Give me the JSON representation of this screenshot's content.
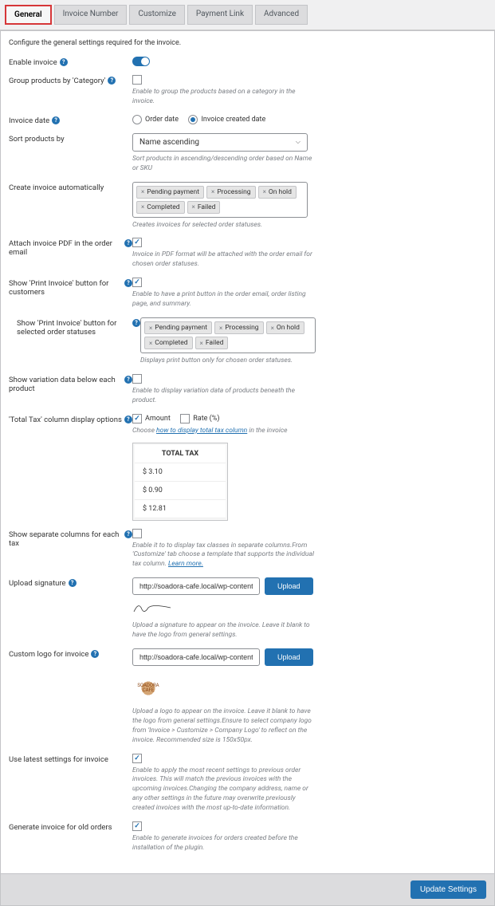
{
  "tabs": [
    "General",
    "Invoice Number",
    "Customize",
    "Payment Link",
    "Advanced"
  ],
  "desc": "Configure the general settings required for the invoice.",
  "statuses": [
    "Pending payment",
    "Processing",
    "On hold",
    "Completed",
    "Failed"
  ],
  "fields": {
    "enable": "Enable invoice",
    "group": "Group products by 'Category'",
    "group_help": "Enable to group the products based on a category in the invoice.",
    "invoice_date": "Invoice date",
    "order_date": "Order date",
    "created_date": "Invoice created date",
    "sort": "Sort products by",
    "sort_val": "Name ascending",
    "sort_help": "Sort products in ascending/descending order based on Name or SKU",
    "auto": "Create invoice automatically",
    "auto_help": "Creates invoices for selected order statuses.",
    "attach": "Attach invoice PDF in the order email",
    "attach_help": "Invoice in PDF format will be attached with the order email for chosen order statuses.",
    "printbtn": "Show 'Print Invoice' button for customers",
    "printbtn_help": "Enable to have a print button in the order email, order listing page, and summary.",
    "printsel": "Show 'Print Invoice' button for selected order statuses",
    "printsel_help": "Displays print button only for chosen order statuses.",
    "variation": "Show variation data below each product",
    "variation_help": "Enable to display variation data of products beneath the product.",
    "totaltax": "'Total Tax' column display options",
    "amount": "Amount",
    "rate": "Rate (%)",
    "totaltax_help1": "Choose ",
    "totaltax_link": "how to display total tax column",
    "totaltax_help2": " in the invoice",
    "tax_header": "TOTAL TAX",
    "tax_vals": [
      "$ 3.10",
      "$ 0.90",
      "$ 12.81"
    ],
    "sepcol": "Show separate columns for each tax",
    "sepcol_help": "Enable it to to display tax classes in separate columns.From 'Customize' tab choose a template that supports the individual tax column. ",
    "sepcol_link": "Learn more.",
    "sig": "Upload signature",
    "sig_val": "http://soadora-cafe.local/wp-content/up",
    "sig_help": "Upload a signature to appear on the invoice. Leave it blank to have the logo from general settings.",
    "logo": "Custom logo for invoice",
    "logo_val": "http://soadora-cafe.local/wp-content/up",
    "logo_help": "Upload a logo to appear on the invoice. Leave it blank to have the logo from general settings.Ensure to select company logo from 'Invoice > Customize > Company Logo' to reflect on the invoice. Recommended size is 150x50px.",
    "latest": "Use latest settings for invoice",
    "latest_help": "Enable to apply the most recent settings to previous order invoices. This will match the previous invoices with the upcoming invoices.Changing the company address, name or any other settings in the future may overwrite previously created invoices with the most up-to-date information.",
    "old": "Generate invoice for old orders",
    "old_help": "Enable to generate invoices for orders created before the installation of the plugin.",
    "upload": "Upload",
    "update": "Update Settings",
    "logo_text": "SOADORA CAFE"
  }
}
